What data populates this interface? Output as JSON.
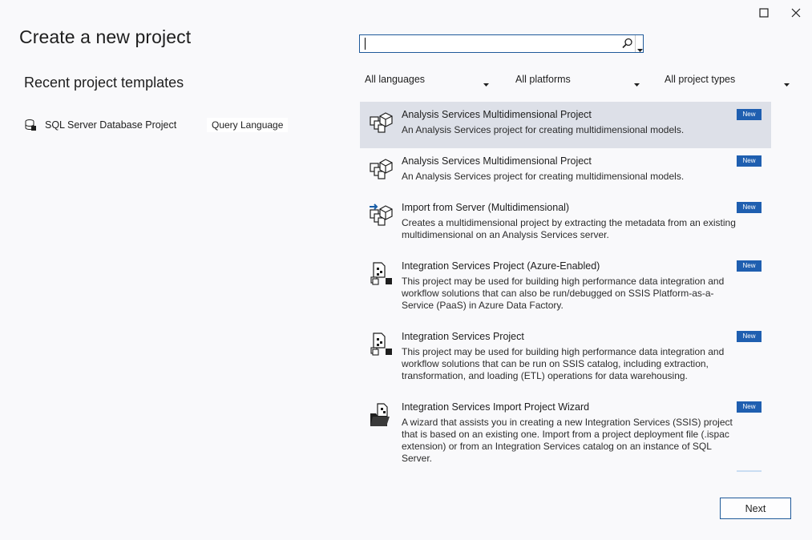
{
  "window": {
    "maximize_icon": "maximize-icon",
    "close_icon": "close-icon"
  },
  "title": "Create a new project",
  "recent": {
    "heading": "Recent project templates",
    "items": [
      {
        "name": "SQL Server Database Project",
        "tag": "Query Language",
        "icon": "database-project-icon"
      }
    ]
  },
  "search": {
    "value": "",
    "placeholder": ""
  },
  "filters": {
    "language": "All languages",
    "platform": "All platforms",
    "project_type": "All project types"
  },
  "templates": [
    {
      "title": "Analysis Services Multidimensional Project",
      "description": "An Analysis Services project for creating multidimensional models.",
      "badge": "New",
      "icon": "cube-project-icon",
      "selected": true
    },
    {
      "title": "Analysis Services Multidimensional Project",
      "description": "An Analysis Services project for creating multidimensional models.",
      "badge": "New",
      "icon": "cube-project-icon"
    },
    {
      "title": "Import from Server (Multidimensional)",
      "description": "Creates a multidimensional project by extracting the metadata from an existing multidimensional on an Analysis Services server.",
      "badge": "New",
      "icon": "import-cube-icon"
    },
    {
      "title": "Integration Services Project (Azure-Enabled)",
      "description": "This project may be used for building high performance data integration and workflow solutions that can also be run/debugged on SSIS Platform-as-a-Service (PaaS) in Azure Data Factory.",
      "badge": "New",
      "icon": "integration-package-icon"
    },
    {
      "title": "Integration Services Project",
      "description": "This project may be used for building high performance data integration and workflow solutions that can be run on SSIS catalog, including extraction, transformation, and loading (ETL) operations for data warehousing.",
      "badge": "New",
      "icon": "integration-package-icon"
    },
    {
      "title": "Integration Services Import Project Wizard",
      "description": "A wizard that assists you in creating a new Integration Services (SSIS) project that is based on an existing one. Import from a project deployment file (.ispac extension) or from an Integration Services catalog on an instance of SQL Server.",
      "badge": "New",
      "icon": "import-wizard-icon"
    }
  ],
  "buttons": {
    "next": "Next"
  }
}
